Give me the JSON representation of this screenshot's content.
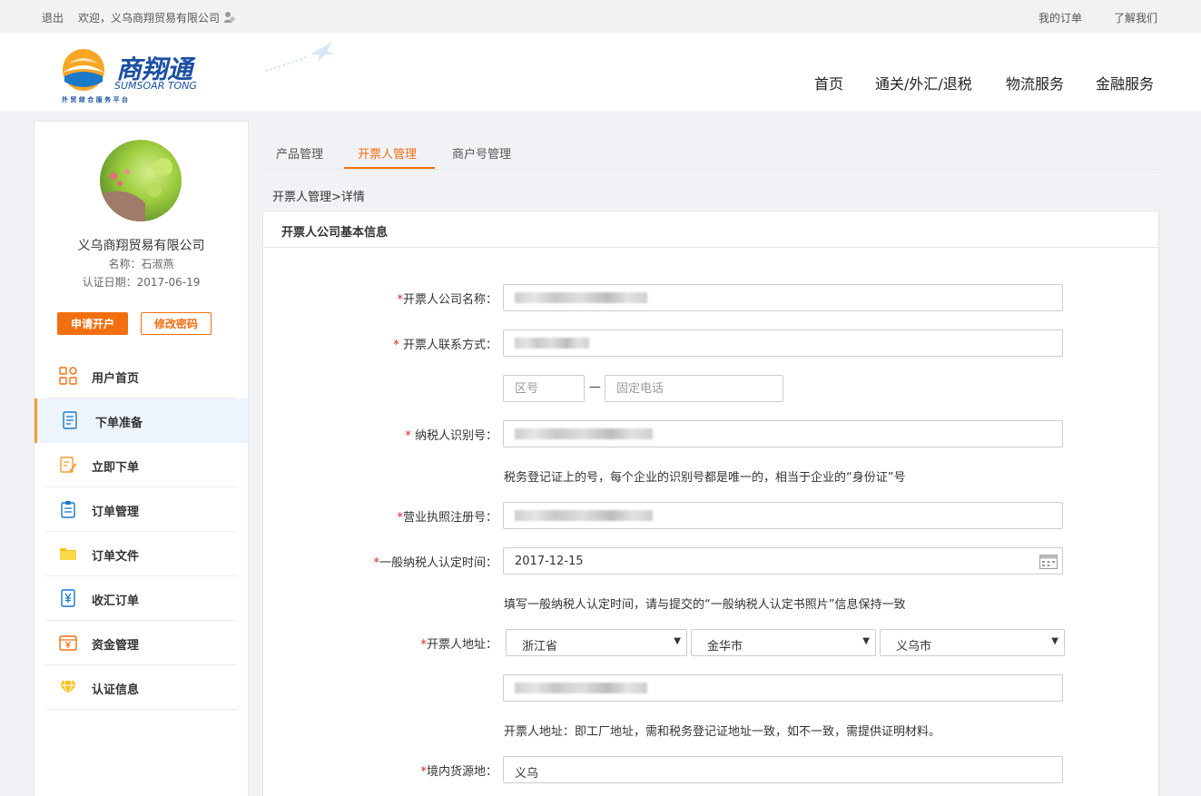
{
  "topbar": {
    "logout": "退出",
    "welcome": "欢迎，义乌商翔贸易有限公司",
    "my_orders": "我的订单",
    "about": "了解我们"
  },
  "header": {
    "brand_cn": "商翔通",
    "brand_en": "SUMSOAR TONG",
    "brand_tagline": "外 贸 综 合 服 务 平 台",
    "nav": [
      "首页",
      "通关/外汇/退税",
      "物流服务",
      "金融服务"
    ]
  },
  "sidebar": {
    "company": "义乌商翔贸易有限公司",
    "person": "名称：石淑燕",
    "cert_date": "认证日期：2017-06-19",
    "apply_btn": "申请开户",
    "pwd_btn": "修改密码",
    "menu": [
      {
        "label": "用户首页",
        "icon": "grid-icon"
      },
      {
        "label": "下单准备",
        "icon": "document-icon"
      },
      {
        "label": "立即下单",
        "icon": "edit-icon"
      },
      {
        "label": "订单管理",
        "icon": "clipboard-icon"
      },
      {
        "label": "订单文件",
        "icon": "folder-icon"
      },
      {
        "label": "收汇订单",
        "icon": "yen-doc-icon"
      },
      {
        "label": "资金管理",
        "icon": "yen-box-icon"
      },
      {
        "label": "认证信息",
        "icon": "diamond-icon"
      }
    ]
  },
  "tabs": [
    "产品管理",
    "开票人管理",
    "商户号管理"
  ],
  "breadcrumb": "开票人管理>详情",
  "panel": {
    "title": "开票人公司基本信息",
    "fields": {
      "company_name": "开票人公司名称：",
      "contact": "开票人联系方式：",
      "area_code_placeholder": "区号",
      "phone_placeholder": "固定电话",
      "taxpayer_id": "纳税人识别号：",
      "taxpayer_hint": "税务登记证上的号，每个企业的识别号都是唯一的，相当于企业的“身份证”号",
      "license_no": "营业执照注册号：",
      "general_taxpayer_date": "一般纳税人认定时间：",
      "general_taxpayer_value": "2017-12-15",
      "date_hint": "填写一般纳税人认定时间，请与提交的“一般纳税人认定书照片”信息保持一致",
      "address": "开票人地址：",
      "province": "浙江省",
      "city": "金华市",
      "county": "义乌市",
      "address_hint": "开票人地址：即工厂地址，需和税务登记证地址一致，如不一致，需提供证明材料。",
      "origin": "境内货源地：",
      "origin_value": "义乌"
    },
    "required_mark": "*"
  },
  "colors": {
    "accent": "#f26f10",
    "active_bg": "#edf4fc",
    "required": "#e02020"
  }
}
